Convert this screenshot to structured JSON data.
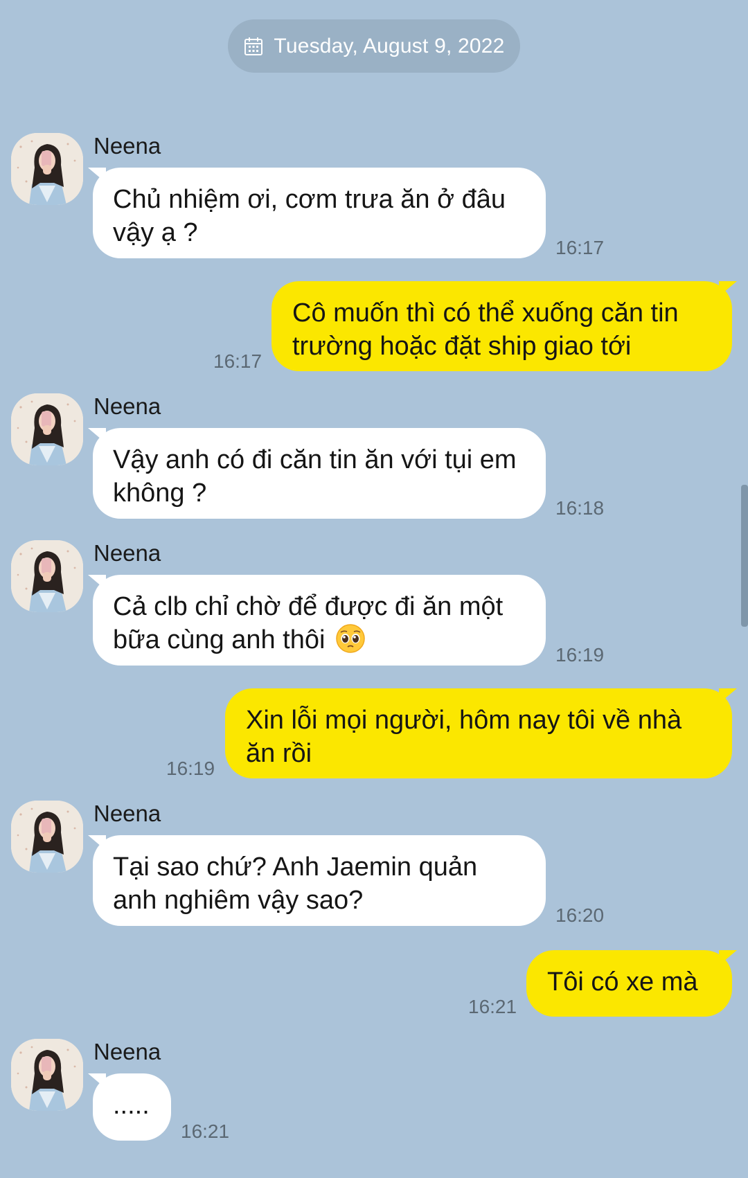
{
  "chat": {
    "date": "Tuesday, August 9, 2022",
    "date_icon": "calendar-icon",
    "messages": [
      {
        "sender": "Neena",
        "text": "Chủ nhiệm ơi, cơm trưa ăn ở đâu vậy ạ ?",
        "time": "16:17",
        "direction": "incoming"
      },
      {
        "text": "Cô muốn thì có thể xuống căn tin trường hoặc đặt ship giao tới",
        "time": "16:17",
        "direction": "outgoing"
      },
      {
        "sender": "Neena",
        "text": "Vậy anh có đi căn tin ăn với tụi em không ?",
        "time": "16:18",
        "direction": "incoming"
      },
      {
        "sender": "Neena",
        "text": "Cả clb chỉ chờ để được đi ăn một bữa cùng anh thôi",
        "emoji": "pleading-face",
        "time": "16:19",
        "direction": "incoming"
      },
      {
        "text": "Xin lỗi mọi người, hôm nay tôi về nhà ăn rồi",
        "time": "16:19",
        "direction": "outgoing"
      },
      {
        "sender": "Neena",
        "text": "Tại sao chứ? Anh Jaemin quản anh nghiêm vậy sao?",
        "time": "16:20",
        "direction": "incoming"
      },
      {
        "text": "Tôi có xe mà",
        "time": "16:21",
        "direction": "outgoing"
      },
      {
        "sender": "Neena",
        "text": ".....",
        "time": "16:21",
        "direction": "incoming"
      }
    ]
  },
  "colors": {
    "background": "#abc3d9",
    "incoming_bubble": "#ffffff",
    "outgoing_bubble": "#fbe700",
    "time_text": "#5b6873"
  }
}
